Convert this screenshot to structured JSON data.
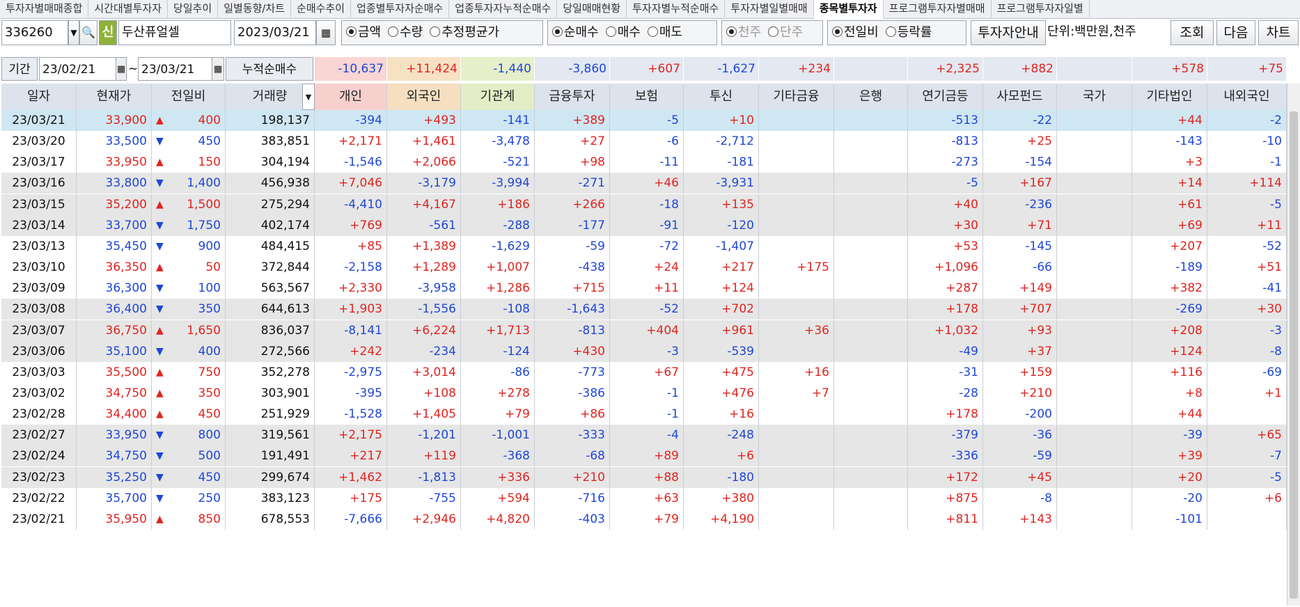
{
  "tabs": [
    "투자자별매매종합",
    "시간대별투자자",
    "당일추이",
    "일별동향/차트",
    "순매수추이",
    "업종별투자자순매수",
    "업종투자자누적순매수",
    "당일매매현황",
    "투자자별누적순매수",
    "투자자별일별매매",
    "종목별투자자",
    "프로그램투자자별매매",
    "프로그램투자자일별"
  ],
  "active_tab": "종목별투자자",
  "toolbar": {
    "code": "336260",
    "new_badge": "신",
    "name": "두산퓨얼셀",
    "date": "2023/03/21",
    "opt1": [
      "금액",
      "수량",
      "추정평균가"
    ],
    "opt2": [
      "순매수",
      "매수",
      "매도"
    ],
    "opt3": [
      "천주",
      "단주"
    ],
    "opt4": [
      "전일비",
      "등락률"
    ],
    "investor_guide": "투자자안내",
    "unit": "단위:백만원,천주",
    "query": "조회",
    "next": "다음",
    "chart": "차트"
  },
  "period": {
    "label": "기간",
    "from": "23/02/21",
    "tilde": "~",
    "to": "23/03/21",
    "cum_label": "누적순매수"
  },
  "summary": [
    "-10,637",
    "+11,424",
    "-1,440",
    "-3,860",
    "+607",
    "-1,627",
    "+234",
    "",
    "+2,325",
    "+882",
    "",
    "+578",
    "+75"
  ],
  "headers": [
    "일자",
    "현재가",
    "전일비",
    "거래량",
    "개인",
    "외국인",
    "기관계",
    "금융투자",
    "보험",
    "투신",
    "기타금융",
    "은행",
    "연기금등",
    "사모펀드",
    "국가",
    "기타법인",
    "내외국인"
  ],
  "rows": [
    {
      "d": "23/03/21",
      "p": "33,900",
      "dir": "up",
      "ch": "400",
      "v": "198,137",
      "vals": [
        "-394",
        "+493",
        "-141",
        "+389",
        "-5",
        "+10",
        "",
        "",
        "-513",
        "-22",
        "",
        "+44",
        "-2"
      ]
    },
    {
      "d": "23/03/20",
      "p": "33,500",
      "dir": "down",
      "ch": "450",
      "v": "383,851",
      "vals": [
        "+2,171",
        "+1,461",
        "-3,478",
        "+27",
        "-6",
        "-2,712",
        "",
        "",
        "-813",
        "+25",
        "",
        "-143",
        "-10"
      ]
    },
    {
      "d": "23/03/17",
      "p": "33,950",
      "dir": "up",
      "ch": "150",
      "v": "304,194",
      "vals": [
        "-1,546",
        "+2,066",
        "-521",
        "+98",
        "-11",
        "-181",
        "",
        "",
        "-273",
        "-154",
        "",
        "+3",
        "-1"
      ]
    },
    {
      "d": "23/03/16",
      "p": "33,800",
      "dir": "down",
      "ch": "1,400",
      "v": "456,938",
      "vals": [
        "+7,046",
        "-3,179",
        "-3,994",
        "-271",
        "+46",
        "-3,931",
        "",
        "",
        "-5",
        "+167",
        "",
        "+14",
        "+114"
      ]
    },
    {
      "d": "23/03/15",
      "p": "35,200",
      "dir": "up",
      "ch": "1,500",
      "v": "275,294",
      "vals": [
        "-4,410",
        "+4,167",
        "+186",
        "+266",
        "-18",
        "+135",
        "",
        "",
        "+40",
        "-236",
        "",
        "+61",
        "-5"
      ]
    },
    {
      "d": "23/03/14",
      "p": "33,700",
      "dir": "down",
      "ch": "1,750",
      "v": "402,174",
      "vals": [
        "+769",
        "-561",
        "-288",
        "-177",
        "-91",
        "-120",
        "",
        "",
        "+30",
        "+71",
        "",
        "+69",
        "+11"
      ]
    },
    {
      "d": "23/03/13",
      "p": "35,450",
      "dir": "down",
      "ch": "900",
      "v": "484,415",
      "vals": [
        "+85",
        "+1,389",
        "-1,629",
        "-59",
        "-72",
        "-1,407",
        "",
        "",
        "+53",
        "-145",
        "",
        "+207",
        "-52"
      ]
    },
    {
      "d": "23/03/10",
      "p": "36,350",
      "dir": "up",
      "ch": "50",
      "v": "372,844",
      "vals": [
        "-2,158",
        "+1,289",
        "+1,007",
        "-438",
        "+24",
        "+217",
        "+175",
        "",
        "+1,096",
        "-66",
        "",
        "-189",
        "+51"
      ]
    },
    {
      "d": "23/03/09",
      "p": "36,300",
      "dir": "down",
      "ch": "100",
      "v": "563,567",
      "vals": [
        "+2,330",
        "-3,958",
        "+1,286",
        "+715",
        "+11",
        "+124",
        "",
        "",
        "+287",
        "+149",
        "",
        "+382",
        "-41"
      ]
    },
    {
      "d": "23/03/08",
      "p": "36,400",
      "dir": "down",
      "ch": "350",
      "v": "644,613",
      "vals": [
        "+1,903",
        "-1,556",
        "-108",
        "-1,643",
        "-52",
        "+702",
        "",
        "",
        "+178",
        "+707",
        "",
        "-269",
        "+30"
      ]
    },
    {
      "d": "23/03/07",
      "p": "36,750",
      "dir": "up",
      "ch": "1,650",
      "v": "836,037",
      "vals": [
        "-8,141",
        "+6,224",
        "+1,713",
        "-813",
        "+404",
        "+961",
        "+36",
        "",
        "+1,032",
        "+93",
        "",
        "+208",
        "-3"
      ]
    },
    {
      "d": "23/03/06",
      "p": "35,100",
      "dir": "down",
      "ch": "400",
      "v": "272,566",
      "vals": [
        "+242",
        "-234",
        "-124",
        "+430",
        "-3",
        "-539",
        "",
        "",
        "-49",
        "+37",
        "",
        "+124",
        "-8"
      ]
    },
    {
      "d": "23/03/03",
      "p": "35,500",
      "dir": "up",
      "ch": "750",
      "v": "352,278",
      "vals": [
        "-2,975",
        "+3,014",
        "-86",
        "-773",
        "+67",
        "+475",
        "+16",
        "",
        "-31",
        "+159",
        "",
        "+116",
        "-69"
      ]
    },
    {
      "d": "23/03/02",
      "p": "34,750",
      "dir": "up",
      "ch": "350",
      "v": "303,901",
      "vals": [
        "-395",
        "+108",
        "+278",
        "-386",
        "-1",
        "+476",
        "+7",
        "",
        "-28",
        "+210",
        "",
        "+8",
        "+1"
      ]
    },
    {
      "d": "23/02/28",
      "p": "34,400",
      "dir": "up",
      "ch": "450",
      "v": "251,929",
      "vals": [
        "-1,528",
        "+1,405",
        "+79",
        "+86",
        "-1",
        "+16",
        "",
        "",
        "+178",
        "-200",
        "",
        "+44",
        ""
      ]
    },
    {
      "d": "23/02/27",
      "p": "33,950",
      "dir": "down",
      "ch": "800",
      "v": "319,561",
      "vals": [
        "+2,175",
        "-1,201",
        "-1,001",
        "-333",
        "-4",
        "-248",
        "",
        "",
        "-379",
        "-36",
        "",
        "-39",
        "+65"
      ]
    },
    {
      "d": "23/02/24",
      "p": "34,750",
      "dir": "down",
      "ch": "500",
      "v": "191,491",
      "vals": [
        "+217",
        "+119",
        "-368",
        "-68",
        "+89",
        "+6",
        "",
        "",
        "-336",
        "-59",
        "",
        "+39",
        "-7"
      ]
    },
    {
      "d": "23/02/23",
      "p": "35,250",
      "dir": "down",
      "ch": "450",
      "v": "299,674",
      "vals": [
        "+1,462",
        "-1,813",
        "+336",
        "+210",
        "+88",
        "-180",
        "",
        "",
        "+172",
        "+45",
        "",
        "+20",
        "-5"
      ]
    },
    {
      "d": "23/02/22",
      "p": "35,700",
      "dir": "down",
      "ch": "250",
      "v": "383,123",
      "vals": [
        "+175",
        "-755",
        "+594",
        "-716",
        "+63",
        "+380",
        "",
        "",
        "+875",
        "-8",
        "",
        "-20",
        "+6"
      ]
    },
    {
      "d": "23/02/21",
      "p": "35,950",
      "dir": "up",
      "ch": "850",
      "v": "678,553",
      "vals": [
        "-7,666",
        "+2,946",
        "+4,820",
        "-403",
        "+79",
        "+4,190",
        "",
        "",
        "+811",
        "+143",
        "",
        "-101",
        ""
      ]
    }
  ],
  "colors": {
    "up": "#e0241f",
    "down": "#1f47d6",
    "selected": "#cfe7f3",
    "band": "#e6e6e6",
    "hdr": "#dde3ec"
  }
}
